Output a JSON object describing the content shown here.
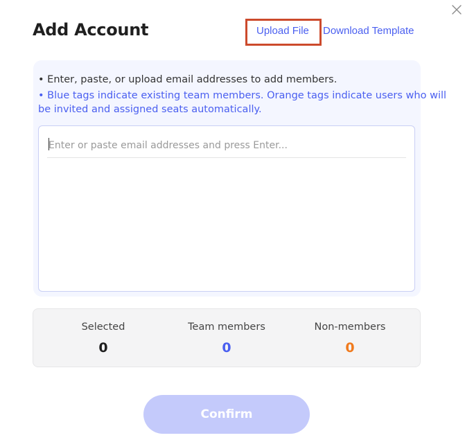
{
  "dialog": {
    "title": "Add Account",
    "close_icon": "close-icon"
  },
  "header_links": {
    "upload_file": "Upload File",
    "download_template": "Download Template"
  },
  "instructions": {
    "line1": "• Enter, paste, or upload email addresses to add members.",
    "line2": "• Blue tags indicate existing team members. Orange tags indicate users who will",
    "line3": "be invited and assigned seats automatically."
  },
  "email_input": {
    "value": "",
    "placeholder": "Enter or paste email addresses and press Enter..."
  },
  "stats": {
    "selected": {
      "label": "Selected",
      "value": "0"
    },
    "team_members": {
      "label": "Team members",
      "value": "0"
    },
    "non_members": {
      "label": "Non-members",
      "value": "0"
    }
  },
  "footer": {
    "confirm_label": "Confirm"
  },
  "colors": {
    "accent": "#4a5ff0",
    "orange": "#f07a1d",
    "highlight_border": "#cc4a2c",
    "confirm_disabled": "#c4cafb"
  }
}
